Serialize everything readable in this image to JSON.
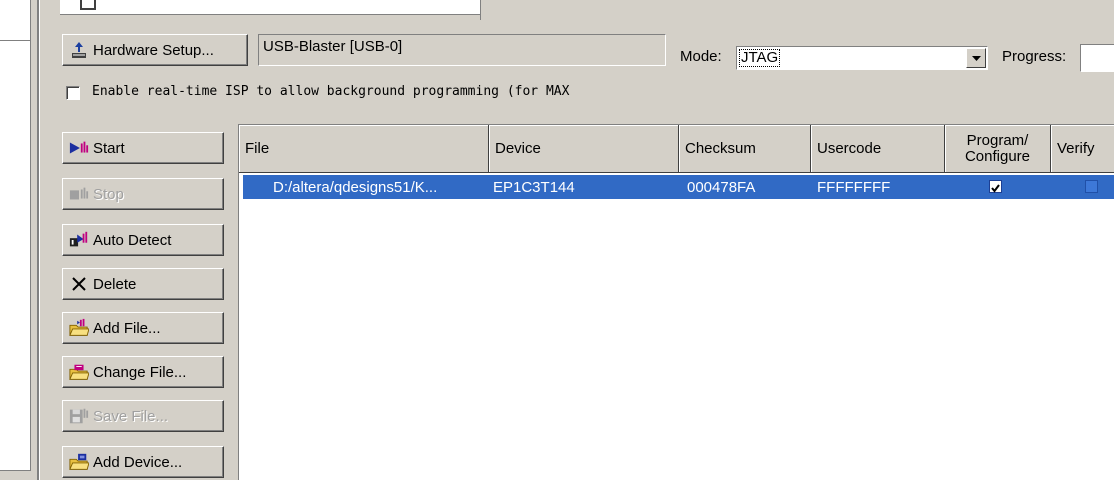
{
  "hardware": {
    "setup_button_label": "Hardware Setup...",
    "device_value": "USB-Blaster [USB-0]",
    "mode_label": "Mode:",
    "mode_value": "JTAG",
    "progress_label": "Progress:"
  },
  "isp_checkbox": {
    "label": "Enable real-time ISP to allow background programming (for MAX",
    "checked": false
  },
  "side_buttons": [
    {
      "label": "Start",
      "enabled": true,
      "icon": "start-icon"
    },
    {
      "label": "Stop",
      "enabled": false,
      "icon": "stop-icon"
    },
    {
      "label": "Auto Detect",
      "enabled": true,
      "icon": "auto-detect-icon"
    },
    {
      "label": "Delete",
      "enabled": true,
      "icon": "delete-x-icon"
    },
    {
      "label": "Add File...",
      "enabled": true,
      "icon": "add-file-icon"
    },
    {
      "label": "Change File...",
      "enabled": true,
      "icon": "change-file-icon"
    },
    {
      "label": "Save File...",
      "enabled": false,
      "icon": "save-file-icon"
    },
    {
      "label": "Add Device...",
      "enabled": true,
      "icon": "add-device-icon"
    }
  ],
  "table": {
    "columns": {
      "file": "File",
      "device": "Device",
      "checksum": "Checksum",
      "usercode": "Usercode",
      "program_line1": "Program/",
      "program_line2": "Configure",
      "verify": "Verify"
    },
    "rows": [
      {
        "file": "D:/altera/qdesigns51/K...",
        "device": "EP1C3T144",
        "checksum": "000478FA",
        "usercode": "FFFFFFFF",
        "program_configure": true,
        "verify": false
      }
    ]
  },
  "colors": {
    "face": "#d4d0c8",
    "selection": "#316ac5"
  }
}
